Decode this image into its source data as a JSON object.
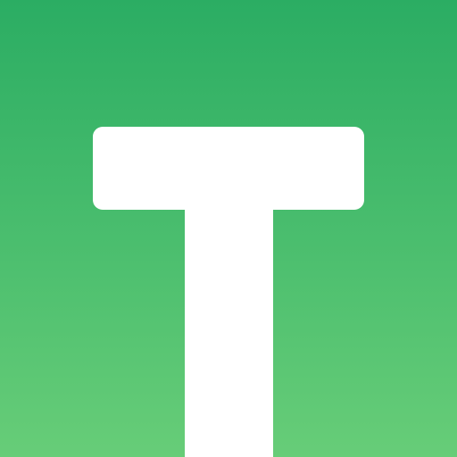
{
  "app_icon": {
    "icon": "letter-t-logo-icon",
    "colors": {
      "gradient_top": "#2bad63",
      "gradient_bottom": "#67cd78",
      "glyph": "#ffffff"
    }
  }
}
